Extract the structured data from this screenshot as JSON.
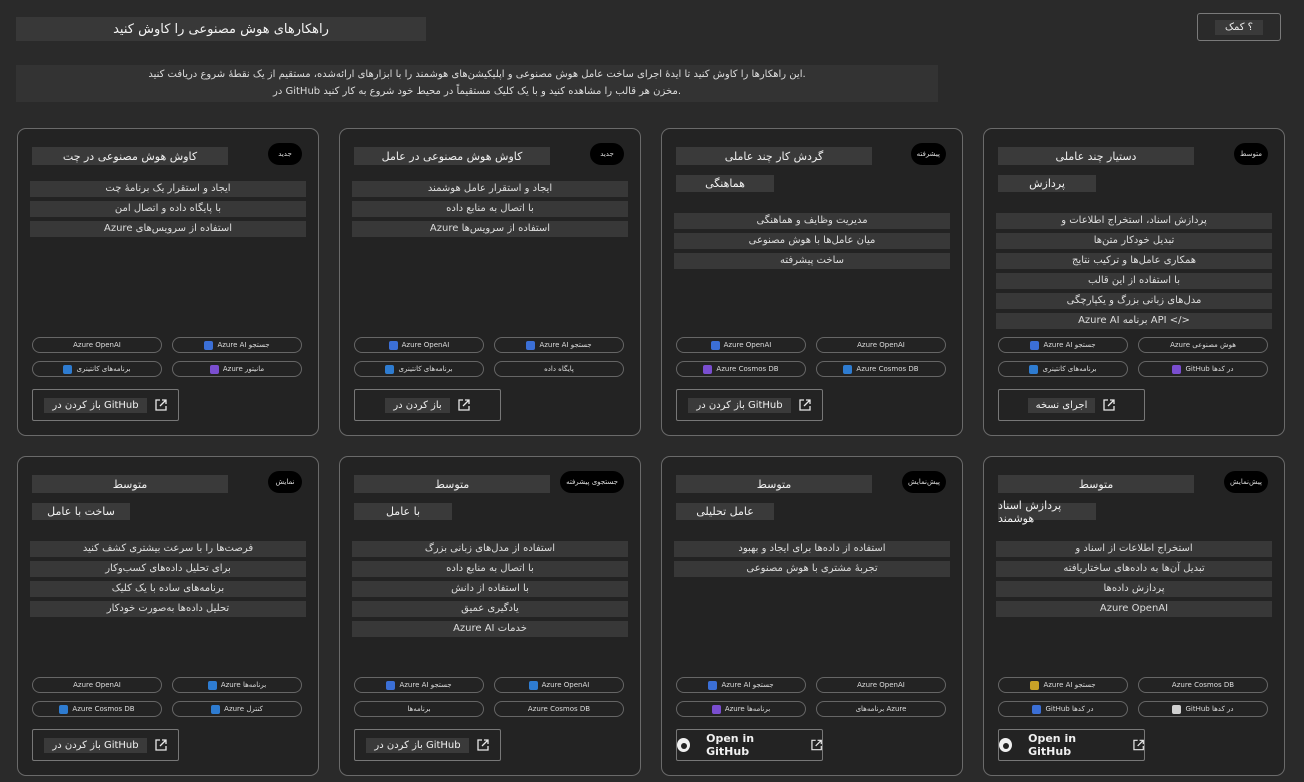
{
  "header": {
    "title": "راهکارهای هوش مصنوعی را کاوش کنید",
    "help_label": "؟ کمک"
  },
  "intro": {
    "line1": "این راهکارها را کاوش کنید تا ایدهٔ اجرای ساخت عامل هوش مصنوعی و اپلیکیشن‌های هوشمند را با ابزارهای ارائه‌شده، مستقیم از یک نقطهٔ شروع دریافت کنید.",
    "line2": "در GitHub مخزن هر قالب را مشاهده کنید و با یک کلیک مستقیماً در محیط خود شروع به کار کنید."
  },
  "cards": [
    {
      "badge": "جدید",
      "title": "کاوش هوش مصنوعی در چت",
      "subtitle": "",
      "desc": [
        "ایجاد و استقرار یک برنامهٔ چت",
        "با پایگاه داده و اتصال امن",
        "Azure استفاده از سرویس‌های"
      ],
      "tags": [
        {
          "label": "Azure OpenAI",
          "icon": ""
        },
        {
          "label": "Azure AI جستجو",
          "icon": "#3b6fd6"
        },
        {
          "label": "برنامه‌های کانتینری",
          "icon": "#2e7cd1"
        },
        {
          "label": "Azure مانیتور",
          "icon": "#7a4ed0"
        }
      ],
      "button": {
        "label": "باز کردن در GitHub",
        "style": "normal"
      }
    },
    {
      "badge": "جدید",
      "title": "کاوش هوش مصنوعی در عامل",
      "subtitle": "",
      "desc": [
        "ایجاد و استقرار عامل هوشمند",
        "با اتصال به منابع داده",
        "Azure استفاده از سرویس‌ها"
      ],
      "tags": [
        {
          "label": "Azure OpenAI",
          "icon": "#3b6fd6"
        },
        {
          "label": "Azure AI جستجو",
          "icon": "#3b6fd6"
        },
        {
          "label": "برنامه‌های کانتینری",
          "icon": "#2e7cd1"
        },
        {
          "label": "پایگاه داده",
          "icon": ""
        }
      ],
      "button": {
        "label": "باز کردن در",
        "style": "normal"
      }
    },
    {
      "badge": "پیشرفته",
      "title": "گردش کار چند عاملی",
      "subtitle": "هماهنگی",
      "desc": [
        "مدیریت وظایف و هماهنگی",
        "میان عامل‌ها با هوش مصنوعی",
        "ساخت پیشرفته"
      ],
      "tags": [
        {
          "label": "Azure OpenAI",
          "icon": "#3b6fd6"
        },
        {
          "label": "Azure OpenAI",
          "icon": ""
        },
        {
          "label": "Azure Cosmos DB",
          "icon": "#7a4ed0"
        },
        {
          "label": "Azure Cosmos DB",
          "icon": "#2e7cd1"
        }
      ],
      "button": {
        "label": "باز کردن در GitHub",
        "style": "normal"
      }
    },
    {
      "badge": "متوسط",
      "title": "دستیار چند عاملی",
      "subtitle": "پردازش",
      "desc": [
        "پردازش اسناد، استخراج اطلاعات و",
        "تبدیل خودکار متن‌ها",
        "همکاری عامل‌ها و ترکیب نتایج",
        "با استفاده از این قالب",
        "مدل‌های زبانی بزرگ و یکپارچگی",
        "Azure AI برنامه API </>"
      ],
      "tags": [
        {
          "label": "Azure AI جستجو",
          "icon": "#3b6fd6"
        },
        {
          "label": "Azure هوش مصنوعی",
          "icon": ""
        },
        {
          "label": "برنامه‌های کانتینری",
          "icon": "#2e7cd1"
        },
        {
          "label": "GitHub در کدها",
          "icon": "#7a4ed0"
        }
      ],
      "button": {
        "label": "اجرای نسخه",
        "style": "normal"
      }
    },
    {
      "badge": "نمایش",
      "title": "متوسط",
      "subtitle": "ساخت با عامل",
      "desc": [
        "فرصت‌ها را با سرعت بیشتری کشف کنید",
        "برای تحلیل داده‌های کسب‌وکار",
        "برنامه‌های ساده با یک کلیک",
        "تحلیل داده‌ها به‌صورت خودکار"
      ],
      "tags": [
        {
          "label": "Azure OpenAI",
          "icon": ""
        },
        {
          "label": "Azure برنامه‌ها",
          "icon": "#2e7cd1"
        },
        {
          "label": "Azure Cosmos DB",
          "icon": "#2e7cd1"
        },
        {
          "label": "Azure کنترل",
          "icon": "#2e7cd1"
        }
      ],
      "button": {
        "label": "باز کردن در GitHub",
        "style": "normal"
      }
    },
    {
      "badge": "جستجوی پیشرفته",
      "title": "متوسط",
      "subtitle": "با عامل",
      "desc": [
        "استفاده از مدل‌های زبانی بزرگ",
        "با اتصال به منابع داده",
        "با استفاده از دانش",
        "یادگیری عمیق",
        "Azure AI خدمات"
      ],
      "tags": [
        {
          "label": "Azure AI جستجو",
          "icon": "#3b6fd6"
        },
        {
          "label": "Azure OpenAI",
          "icon": "#2e7cd1"
        },
        {
          "label": "برنامه‌ها",
          "icon": ""
        },
        {
          "label": "Azure Cosmos DB",
          "icon": ""
        }
      ],
      "button": {
        "label": "باز کردن در GitHub",
        "style": "normal"
      }
    },
    {
      "badge": "پیش‌نمایش",
      "title": "متوسط",
      "subtitle": "عامل تحلیلی",
      "desc": [
        "استفاده از داده‌ها برای ایجاد و بهبود",
        "تجربهٔ مشتری با هوش مصنوعی"
      ],
      "tags": [
        {
          "label": "Azure AI جستجو",
          "icon": "#3b6fd6"
        },
        {
          "label": "Azure OpenAI",
          "icon": ""
        },
        {
          "label": "Azure برنامه‌ها",
          "icon": "#7a4ed0"
        },
        {
          "label": "برنامه‌های Azure",
          "icon": ""
        }
      ],
      "button": {
        "label": "Open in GitHub",
        "style": "github"
      }
    },
    {
      "badge": "پیش‌نمایش",
      "title": "متوسط",
      "subtitle": "پردازش اسناد هوشمند",
      "desc": [
        "استخراج اطلاعات از اسناد و",
        "تبدیل آن‌ها به داده‌های ساختاریافته",
        "پردازش داده‌ها",
        "Azure OpenAI"
      ],
      "tags": [
        {
          "label": "Azure AI جستجو",
          "icon": "#c9a227"
        },
        {
          "label": "Azure Cosmos DB",
          "icon": ""
        },
        {
          "label": "GitHub در کدها",
          "icon": "#3b6fd6"
        },
        {
          "label": "GitHub در کدها",
          "icon": "#d0d0d0"
        }
      ],
      "button": {
        "label": "Open in GitHub",
        "style": "github"
      }
    }
  ]
}
